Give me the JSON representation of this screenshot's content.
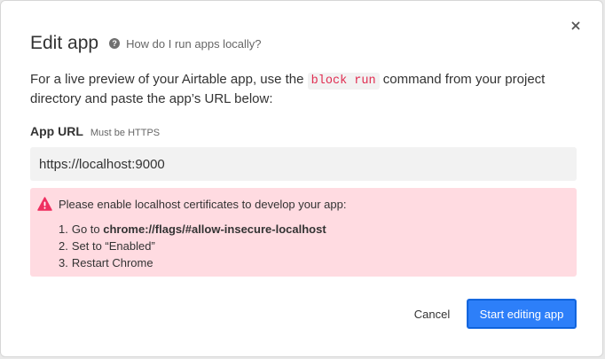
{
  "dialog": {
    "title": "Edit app",
    "help_icon": "question-circle-icon",
    "help_link": "How do I run apps locally?",
    "close_icon": "close-icon"
  },
  "description": {
    "before_code": "For a live preview of your Airtable app, use the ",
    "code": "block run",
    "after_code": " command from your project directory and paste the app’s URL below:"
  },
  "url_field": {
    "label": "App URL",
    "hint": "Must be HTTPS",
    "value": "https://localhost:9000"
  },
  "alert": {
    "icon": "warning-triangle-icon",
    "heading": "Please enable localhost certificates to develop your app:",
    "steps": [
      {
        "num": "1.",
        "prefix": "Go to ",
        "bold": "chrome://flags/#allow-insecure-localhost",
        "suffix": ""
      },
      {
        "num": "2.",
        "prefix": "Set to “Enabled”",
        "bold": "",
        "suffix": ""
      },
      {
        "num": "3.",
        "prefix": "Restart Chrome",
        "bold": "",
        "suffix": ""
      }
    ]
  },
  "footer": {
    "cancel_label": "Cancel",
    "primary_label": "Start editing app"
  },
  "colors": {
    "primary": "#2d7ff9",
    "alert_bg": "#ffdbe1",
    "alert_icon": "#ef3061",
    "code_text": "#e02c50"
  }
}
